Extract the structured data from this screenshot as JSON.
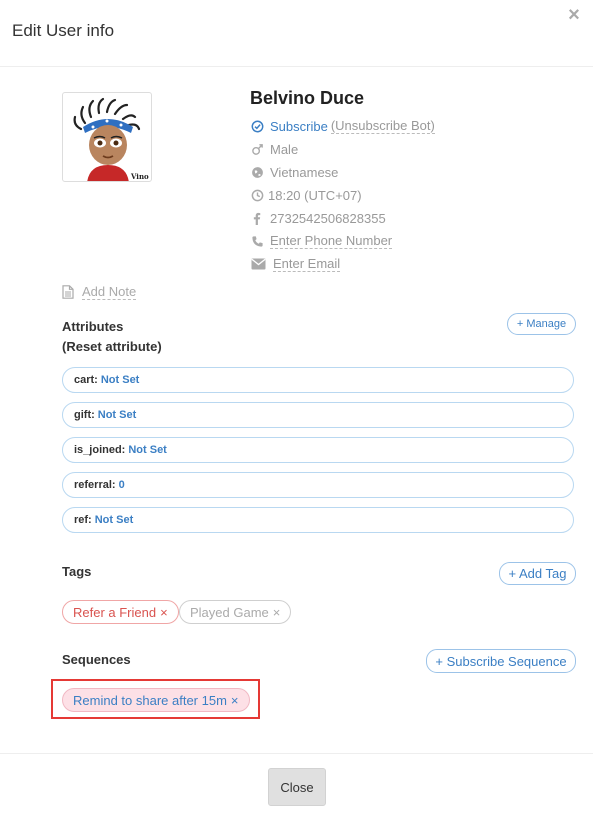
{
  "modal": {
    "title": "Edit User info",
    "close_icon": "close-icon"
  },
  "profile": {
    "name": "Belvino Duce",
    "avatar_caption": "Vino",
    "subscribe_label": "Subscribe",
    "unsubscribe_label": "(Unsubscribe Bot)",
    "gender": "Male",
    "locale": "Vietnamese",
    "timezone": "18:20 (UTC+07)",
    "facebook_id": "2732542506828355",
    "phone_placeholder": "Enter Phone Number",
    "email_placeholder": "Enter Email"
  },
  "note": {
    "label": "Add Note"
  },
  "attributes": {
    "title": "Attributes",
    "reset_label": "(Reset attribute)",
    "manage_label": "+ Manage",
    "items": [
      {
        "key": "cart:",
        "value": "Not Set"
      },
      {
        "key": "gift:",
        "value": "Not Set"
      },
      {
        "key": "is_joined:",
        "value": "Not Set"
      },
      {
        "key": "referral:",
        "value": "0"
      },
      {
        "key": "ref:",
        "value": "Not Set"
      }
    ]
  },
  "tags": {
    "title": "Tags",
    "add_label": "+ Add Tag",
    "items": [
      {
        "label": "Refer a Friend",
        "remove": "×"
      },
      {
        "label": "Played Game",
        "remove": "×"
      }
    ]
  },
  "sequences": {
    "title": "Sequences",
    "subscribe_label": "+ Subscribe Sequence",
    "items": [
      {
        "label": "Remind to share after 15m",
        "remove": "×"
      }
    ]
  },
  "footer": {
    "close_label": "Close"
  },
  "colors": {
    "link": "#3b7fc4",
    "tag_red": "#d9534f",
    "highlight": "#e53935"
  }
}
